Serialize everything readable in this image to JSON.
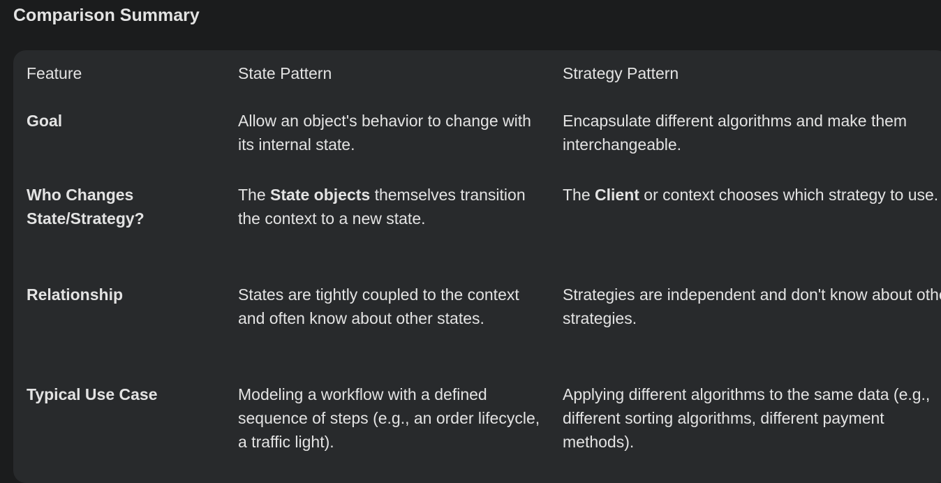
{
  "heading": "Comparison Summary",
  "columns": [
    "Feature",
    "State Pattern",
    "Strategy Pattern"
  ],
  "rows": [
    {
      "feature": "Goal",
      "state": "Allow an object's behavior to change with its internal state.",
      "strategy": "Encapsulate different algorithms and make them interchangeable."
    },
    {
      "feature": "Who Changes State/Strategy?",
      "state_pre": "The ",
      "state_bold": "State objects",
      "state_post": " themselves transition the context to a new state.",
      "strategy_pre": "The ",
      "strategy_bold": "Client",
      "strategy_post": " or context chooses which strategy to use."
    },
    {
      "feature": "Relationship",
      "state": "States are tightly coupled to the context and often know about other states.",
      "strategy": "Strategies are independent and don't know about other strategies."
    },
    {
      "feature": "Typical Use Case",
      "state": "Modeling a workflow with a defined sequence of steps (e.g., an order lifecycle, a traffic light).",
      "strategy": "Applying different algorithms to the same data (e.g., different sorting algorithms, different payment methods)."
    }
  ]
}
